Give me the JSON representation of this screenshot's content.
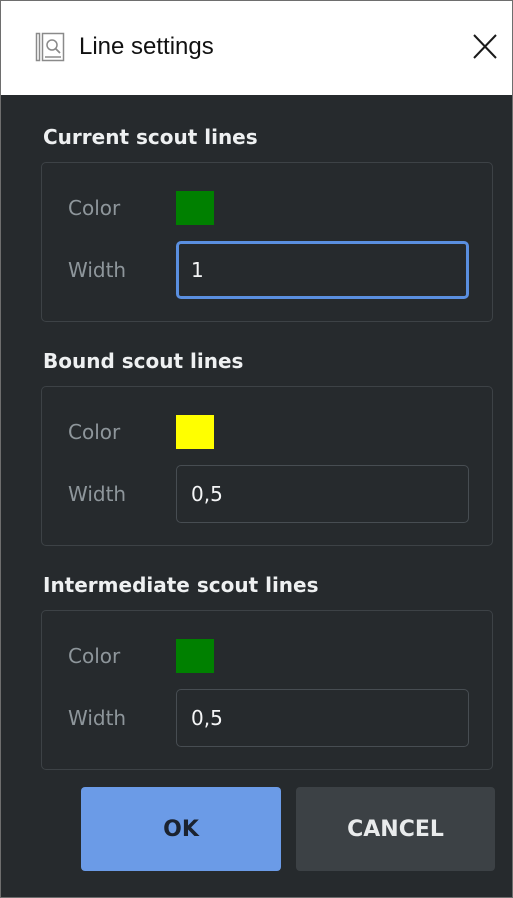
{
  "window": {
    "title": "Line settings",
    "title_icon": "window-app-icon",
    "close_icon": "close-icon"
  },
  "colors": {
    "background": "#262a2d",
    "accent": "#6b9be7"
  },
  "sections": [
    {
      "title": "Current scout lines",
      "color_label": "Color",
      "color_value": "#008000",
      "width_label": "Width",
      "width_value": "1",
      "focused": true
    },
    {
      "title": "Bound scout lines",
      "color_label": "Color",
      "color_value": "#ffff00",
      "width_label": "Width",
      "width_value": "0,5",
      "focused": false
    },
    {
      "title": "Intermediate scout lines",
      "color_label": "Color",
      "color_value": "#008000",
      "width_label": "Width",
      "width_value": "0,5",
      "focused": false
    }
  ],
  "buttons": {
    "ok_label": "OK",
    "cancel_label": "CANCEL"
  }
}
